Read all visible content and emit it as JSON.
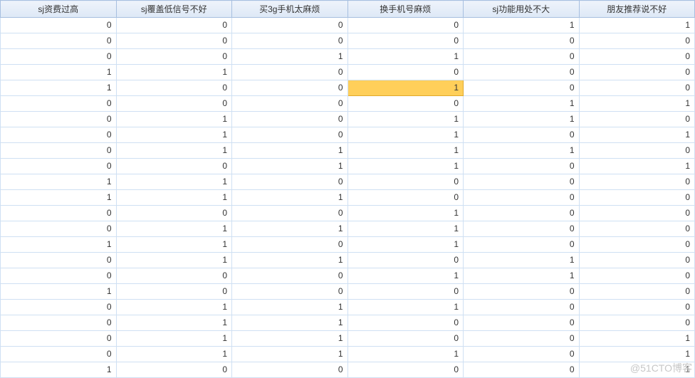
{
  "table": {
    "headers": [
      "sj资费过高",
      "sj覆盖低信号不好",
      "买3g手机太麻烦",
      "换手机号麻烦",
      "sj功能用处不大",
      "朋友推荐说不好"
    ],
    "rows": [
      [
        0,
        0,
        0,
        0,
        1,
        1
      ],
      [
        0,
        0,
        0,
        0,
        0,
        0
      ],
      [
        0,
        0,
        1,
        1,
        0,
        0
      ],
      [
        1,
        1,
        0,
        0,
        0,
        0
      ],
      [
        1,
        0,
        0,
        1,
        0,
        0
      ],
      [
        0,
        0,
        0,
        0,
        1,
        1
      ],
      [
        0,
        1,
        0,
        1,
        1,
        0
      ],
      [
        0,
        1,
        0,
        1,
        0,
        1
      ],
      [
        0,
        1,
        1,
        1,
        1,
        0
      ],
      [
        0,
        0,
        1,
        1,
        0,
        1
      ],
      [
        1,
        1,
        0,
        0,
        0,
        0
      ],
      [
        1,
        1,
        1,
        0,
        0,
        0
      ],
      [
        0,
        0,
        0,
        1,
        0,
        0
      ],
      [
        0,
        1,
        1,
        1,
        0,
        0
      ],
      [
        1,
        1,
        0,
        1,
        0,
        0
      ],
      [
        0,
        1,
        1,
        0,
        1,
        0
      ],
      [
        0,
        0,
        0,
        1,
        1,
        0
      ],
      [
        1,
        0,
        0,
        0,
        0,
        0
      ],
      [
        0,
        1,
        1,
        1,
        0,
        0
      ],
      [
        0,
        1,
        1,
        0,
        0,
        0
      ],
      [
        0,
        1,
        1,
        0,
        0,
        1
      ],
      [
        0,
        1,
        1,
        1,
        0,
        1
      ],
      [
        1,
        0,
        0,
        0,
        0,
        1
      ]
    ],
    "selected": {
      "row": 4,
      "col": 3
    }
  },
  "watermark": "@51CTO博客"
}
